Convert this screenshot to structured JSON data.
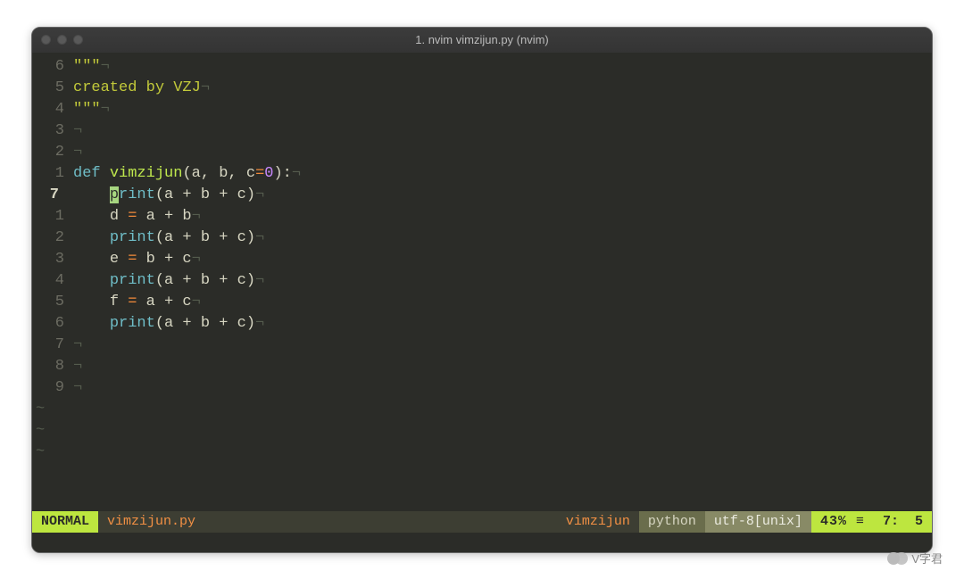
{
  "window": {
    "title": "1. nvim vimzijun.py (nvim)"
  },
  "gutter": {
    "l0": "6",
    "l1": "5",
    "l2": "4",
    "l3": "3",
    "l4": "2",
    "l5": "1",
    "l6": "7",
    "l7": "1",
    "l8": "2",
    "l9": "3",
    "l10": "4",
    "l11": "5",
    "l12": "6",
    "l13": "7",
    "l14": "8",
    "l15": "9"
  },
  "code": {
    "triple_quote": "\"\"\"",
    "doc_line": "created by VZJ",
    "eol": "¬",
    "def_kw": "def",
    "fn_name": "vimzijun",
    "params_open": "(a, b, c",
    "eq": "=",
    "zero": "0",
    "params_close": "):",
    "indent": "    ",
    "print_kw": "print",
    "cursor_char": "p",
    "rint": "rint",
    "args": "(a + b + c)",
    "assign_d": "d ",
    "assign_d_rhs": " a + b",
    "assign_e": "e ",
    "assign_e_rhs": " b + c",
    "assign_f": "f ",
    "assign_f_rhs": " a + c"
  },
  "tilde": "~",
  "status": {
    "mode": "NORMAL",
    "file": "vimzijun.py",
    "func": "vimzijun",
    "filetype": "python",
    "encoding": "utf-8[unix]",
    "percent": "43% ≡",
    "line": "7:",
    "col": "5"
  },
  "watermark": "V字君"
}
